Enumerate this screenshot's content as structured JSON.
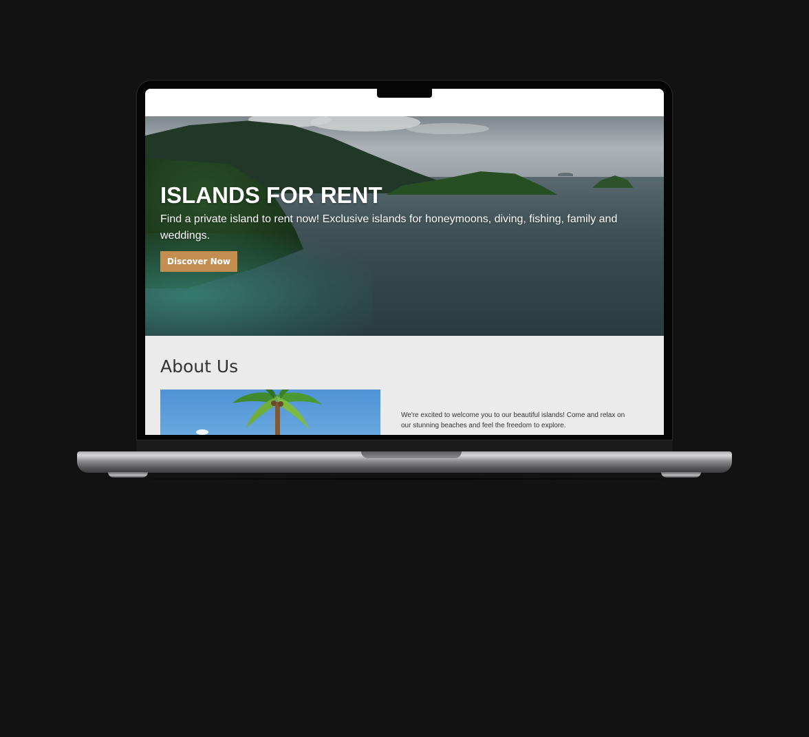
{
  "hero": {
    "title": "ISLANDS FOR RENT",
    "subtitle": "Find a private island to rent now! Exclusive islands for honeymoons, diving, fishing, family and weddings.",
    "button_label": "Discover Now",
    "button_color": "#c48e51"
  },
  "about": {
    "title": "About Us",
    "text": "We're excited to welcome you to our beautiful islands! Come and relax on our stunning beaches and feel the freedom to explore."
  },
  "colors": {
    "background": "#121212",
    "about_background": "#ebebeb"
  }
}
